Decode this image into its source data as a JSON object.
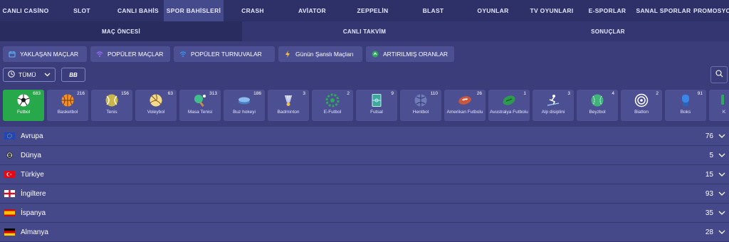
{
  "topnav": {
    "items": [
      "CANLI CASİNO",
      "SLOT",
      "CANLI BAHİS",
      "SPOR BAHİSLERİ",
      "CRASH",
      "AVİATOR",
      "ZEPPELİN",
      "BLAST",
      "OYUNLAR",
      "TV OYUNLARI",
      "E-SPORLAR",
      "SANAL SPORLAR",
      "PROMOSYONLAR"
    ],
    "active": "SPOR BAHİSLERİ"
  },
  "subtabs": {
    "items": [
      "MAÇ ÖNCESİ",
      "CANLI TAKVİM",
      "SONUÇLAR"
    ],
    "active": "MAÇ ÖNCESİ"
  },
  "quick_filters": [
    {
      "label": "YAKLAŞAN MAÇLAR",
      "icon": "calendar-icon"
    },
    {
      "label": "POPÜLER MAÇLAR",
      "icon": "wifi-icon"
    },
    {
      "label": "POPÜLER TURNUVALAR",
      "icon": "wifi-icon"
    },
    {
      "label": "Günün Şanslı Maçları",
      "icon": "lightning-icon"
    },
    {
      "label": "ARTIRILMIŞ ORANLAR",
      "icon": "boost-icon"
    }
  ],
  "filter": {
    "time_select": "TÜMÜ",
    "bb_label": "BB"
  },
  "sports": [
    {
      "name": "Futbol",
      "count": "683",
      "icon": "soccer-ball-icon",
      "active": true
    },
    {
      "name": "Basketbol",
      "count": "216",
      "icon": "basketball-icon"
    },
    {
      "name": "Tenis",
      "count": "156",
      "icon": "tennis-ball-icon"
    },
    {
      "name": "Voleybol",
      "count": "63",
      "icon": "volleyball-icon"
    },
    {
      "name": "Masa Tenisi",
      "count": "313",
      "icon": "ping-pong-icon"
    },
    {
      "name": "Buz hokeyi",
      "count": "186",
      "icon": "hockey-puck-icon"
    },
    {
      "name": "Badminton",
      "count": "3",
      "icon": "shuttlecock-icon"
    },
    {
      "name": "E-Futbol",
      "count": "2",
      "icon": "e-football-icon"
    },
    {
      "name": "Futsal",
      "count": "9",
      "icon": "futsal-pitch-icon"
    },
    {
      "name": "Hentbol",
      "count": "110",
      "icon": "handball-icon"
    },
    {
      "name": "Amerikan Futbolu",
      "count": "26",
      "icon": "american-football-icon"
    },
    {
      "name": "Avustralya Futbolu",
      "count": "1",
      "icon": "aussie-football-icon"
    },
    {
      "name": "Alp disiplini",
      "count": "3",
      "icon": "skier-icon"
    },
    {
      "name": "Beyzbol",
      "count": "4",
      "icon": "baseball-icon"
    },
    {
      "name": "Biatlon",
      "count": "2",
      "icon": "target-icon"
    },
    {
      "name": "Boks",
      "count": "91",
      "icon": "boxing-glove-icon"
    },
    {
      "name": "K",
      "count": "",
      "icon": "cricket-icon"
    }
  ],
  "countries": [
    {
      "name": "Avrupa",
      "count": "76",
      "flag": "eu"
    },
    {
      "name": "Dünya",
      "count": "5",
      "flag": "world"
    },
    {
      "name": "Türkiye",
      "count": "15",
      "flag": "tr"
    },
    {
      "name": "İngiltere",
      "count": "93",
      "flag": "en"
    },
    {
      "name": "İspanya",
      "count": "35",
      "flag": "es"
    },
    {
      "name": "Almanya",
      "count": "28",
      "flag": "de"
    }
  ],
  "colors": {
    "accent_active": "#27a84a",
    "tile_bg": "#4c5092",
    "page_bg": "#3b3d7a"
  }
}
